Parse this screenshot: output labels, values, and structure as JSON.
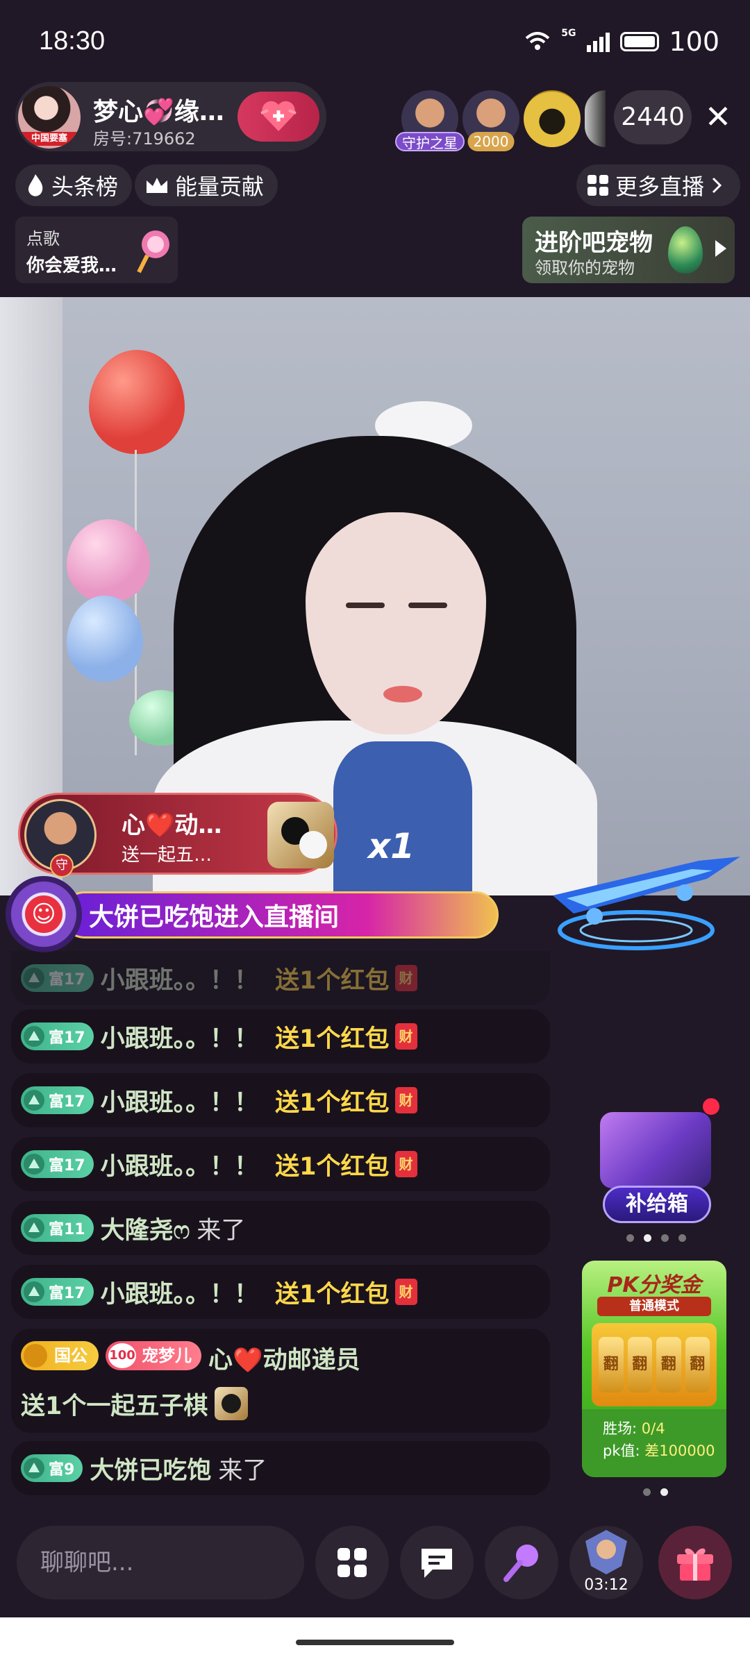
{
  "status_bar": {
    "time": "18:30",
    "network": "5G",
    "battery": "100"
  },
  "host": {
    "name": "梦心💞缘…",
    "room": "房号:719662",
    "avatar_tag": "中国要塞",
    "follow_icon": "plus-heart-icon"
  },
  "viewers": [
    {
      "tag": "守护之星",
      "tag_color": "#7b4cc8"
    },
    {
      "tag": "2000",
      "tag_color": "#d8a54c"
    },
    {
      "tag": "",
      "tag_color": ""
    },
    {
      "tag": "",
      "tag_color": ""
    }
  ],
  "viewer_count": "2440",
  "top_nav": {
    "headline_rank": "头条榜",
    "energy_contrib": "能量贡献",
    "more_live": "更多直播"
  },
  "song_request": {
    "label": "点歌",
    "song": "你会爱我…"
  },
  "pet_promo": {
    "title": "进阶吧宠物",
    "subtitle": "领取你的宠物"
  },
  "gift_banner": {
    "name": "心❤️动…",
    "desc": "送一起五…",
    "avatar_badge": "守",
    "multiplier": "x1"
  },
  "enter_banner": {
    "text": "大饼已吃饱进入直播间"
  },
  "chat": [
    {
      "level": "富17",
      "user": "小跟班。。！！",
      "message": "送1个红包",
      "type": "redpack",
      "faded": true
    },
    {
      "level": "富17",
      "user": "小跟班。。！！",
      "message": "送1个红包",
      "type": "redpack"
    },
    {
      "level": "富17",
      "user": "小跟班。。！！",
      "message": "送1个红包",
      "type": "redpack"
    },
    {
      "level": "富17",
      "user": "小跟班。。！！",
      "message": "送1个红包",
      "type": "redpack"
    },
    {
      "level": "富11",
      "user": "大隆尧ෆ",
      "message": "来了",
      "type": "join"
    },
    {
      "level": "富17",
      "user": "小跟班。。！！",
      "message": "送1个红包",
      "type": "redpack"
    },
    {
      "guild": "国公",
      "fan_level": "100",
      "fan_name": "宠梦儿",
      "user": "心❤️动邮递员",
      "message": "送1个一起五子棋",
      "type": "gift"
    },
    {
      "level": "富9",
      "user": "大饼已吃饱",
      "message": "来了",
      "type": "join"
    }
  ],
  "redpack_char": "财",
  "supply_box": {
    "label": "补给箱"
  },
  "pk_card": {
    "title": "PK分奖金",
    "mode": "普通模式",
    "slot_char": "翻",
    "wins_label": "胜场:",
    "wins_value": "0/4",
    "pk_label": "pk值:",
    "pk_value": "差100000"
  },
  "bottom_bar": {
    "chat_placeholder": "聊聊吧...",
    "timer": "03:12"
  },
  "colors": {
    "accent_pink": "#d6385f",
    "level_green": "#3fb38a",
    "gold": "#ffd84a"
  }
}
